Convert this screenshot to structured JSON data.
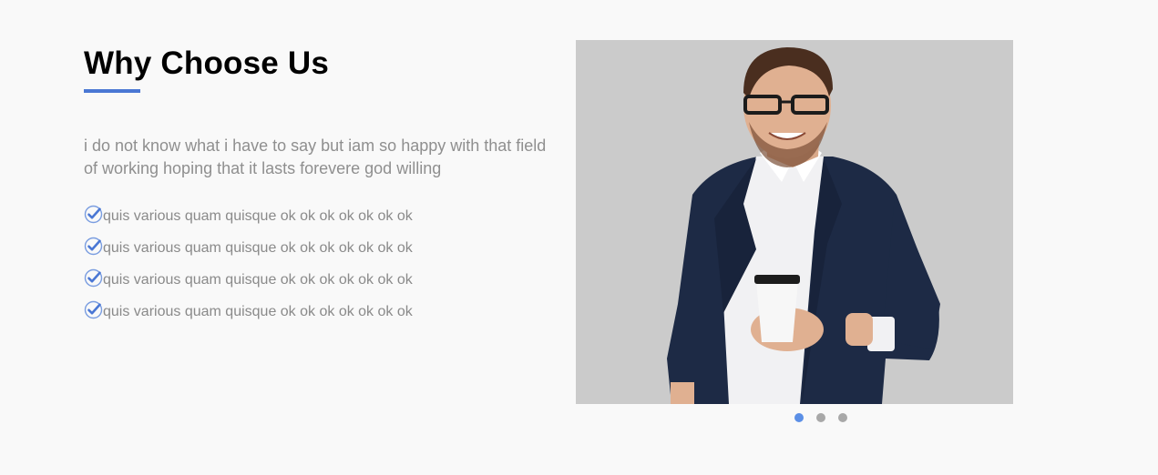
{
  "section": {
    "title": "Why Choose Us",
    "intro": "i do not know what i have to say but iam so happy with that field of working hoping that it lasts forevere god willing",
    "features": [
      {
        "label": "quis various quam quisque ok ok ok ok ok ok ok",
        "icon": "check-circle-icon"
      },
      {
        "label": "quis various quam quisque ok ok ok ok ok ok ok",
        "icon": "check-circle-icon"
      },
      {
        "label": "quis various quam quisque ok ok ok ok ok ok ok",
        "icon": "check-circle-icon"
      },
      {
        "label": "quis various quam quisque ok ok ok ok ok ok ok",
        "icon": "check-circle-icon"
      }
    ]
  },
  "carousel": {
    "slide_count": 3,
    "active_index": 0,
    "image_subject": "smiling man with glasses in navy blazer holding coffee cup"
  },
  "colors": {
    "accent": "#4a77d4",
    "background": "#f9f9f9",
    "text_muted": "#8f8f8f",
    "dot_active": "#5b8fe6",
    "dot_inactive": "#a8a8a8"
  }
}
